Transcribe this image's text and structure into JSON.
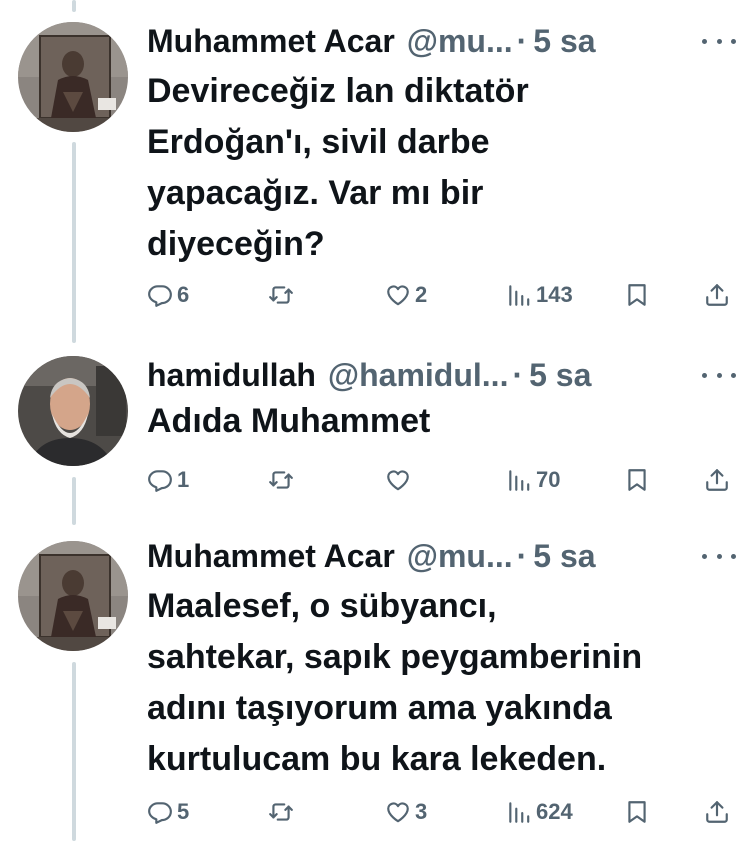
{
  "tweets": [
    {
      "author": "Muhammet Acar",
      "handle": "@mu...",
      "separator": "·",
      "time": "5 sa",
      "text": "Devireceğiz lan diktatör\nErdoğan'ı, sivil darbe\nyapacağız. Var mı bir\ndiyeceğin?",
      "replies": "6",
      "retweets": "",
      "likes": "2",
      "views": "143"
    },
    {
      "author": "hamidullah",
      "handle": "@hamidul...",
      "separator": "·",
      "time": "5 sa",
      "text": "Adıda Muhammet",
      "replies": "1",
      "retweets": "",
      "likes": "",
      "views": "70"
    },
    {
      "author": "Muhammet Acar",
      "handle": "@mu...",
      "separator": "·",
      "time": "5 sa",
      "text": "Maalesef, o sübyancı,\nsahtekar, sapık peygamberinin\nadını taşıyorum ama yakında\nkurtulucam bu kara lekeden.",
      "replies": "5",
      "retweets": "",
      "likes": "3",
      "views": "624"
    }
  ],
  "colors": {
    "text_primary": "#0f1419",
    "text_secondary": "#536471",
    "thread_line": "#cfd9de",
    "background": "#ffffff"
  },
  "icons": [
    "reply-icon",
    "retweet-icon",
    "like-icon",
    "views-icon",
    "bookmark-icon",
    "share-icon",
    "more-icon"
  ]
}
